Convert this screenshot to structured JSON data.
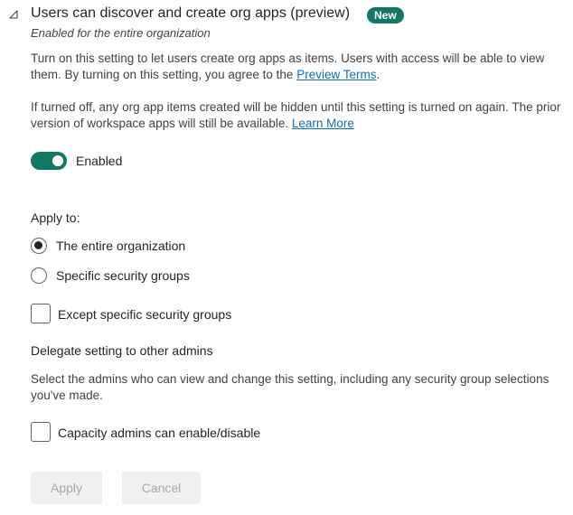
{
  "setting": {
    "title": "Users can discover and create org apps (preview)",
    "badge": "New",
    "subtitle": "Enabled for the entire organization",
    "description_1": "Turn on this setting to let users create org apps as items. Users with access will be able to view them. By turning on this setting, you agree to the ",
    "description_1_link": "Preview Terms",
    "description_1_end": ".",
    "description_2": "If turned off, any org app items created will be hidden until this setting is turned on again. The prior version of workspace apps will still be available. ",
    "description_2_link": "Learn More",
    "toggle": {
      "state": true,
      "label": "Enabled"
    }
  },
  "apply_to": {
    "heading": "Apply to:",
    "options": [
      {
        "label": "The entire organization",
        "selected": true
      },
      {
        "label": "Specific security groups",
        "selected": false
      }
    ],
    "except_checkbox": {
      "label": "Except specific security groups",
      "checked": false
    }
  },
  "delegate": {
    "heading": "Delegate setting to other admins",
    "description": "Select the admins who can view and change this setting, including any security group selections you've made.",
    "capacity_checkbox": {
      "label": "Capacity admins can enable/disable",
      "checked": false
    }
  },
  "actions": {
    "apply_label": "Apply",
    "cancel_label": "Cancel",
    "disabled": true
  },
  "colors": {
    "accent": "#117865",
    "link": "#0f6cbd",
    "disabled_text": "#a8a8a8",
    "disabled_bg": "#f0f0f0"
  },
  "icons": {
    "collapse": "collapse-triangle-icon"
  }
}
